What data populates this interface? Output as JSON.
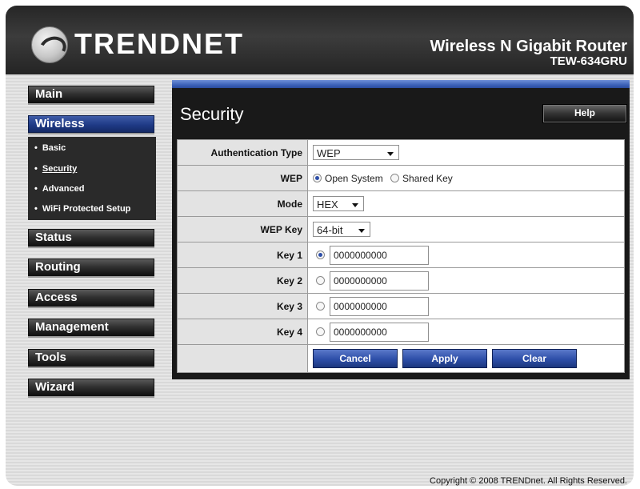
{
  "header": {
    "brand": "TRENDNET",
    "product_name": "Wireless N Gigabit Router",
    "model": "TEW-634GRU"
  },
  "sidebar": {
    "items": [
      {
        "label": "Main"
      },
      {
        "label": "Wireless",
        "active": true
      },
      {
        "label": "Status"
      },
      {
        "label": "Routing"
      },
      {
        "label": "Access"
      },
      {
        "label": "Management"
      },
      {
        "label": "Tools"
      },
      {
        "label": "Wizard"
      }
    ],
    "submenu": [
      {
        "label": "Basic"
      },
      {
        "label": "Security",
        "current": true
      },
      {
        "label": "Advanced"
      },
      {
        "label": "WiFi Protected Setup"
      }
    ]
  },
  "main": {
    "title": "Security",
    "help_label": "Help",
    "fields": {
      "auth_type": {
        "label": "Authentication Type",
        "value": "WEP"
      },
      "wep": {
        "label": "WEP",
        "options": [
          "Open System",
          "Shared Key"
        ],
        "selected": "Open System"
      },
      "mode": {
        "label": "Mode",
        "value": "HEX"
      },
      "wep_key": {
        "label": "WEP Key",
        "value": "64-bit"
      },
      "keys": [
        {
          "label": "Key 1",
          "value": "0000000000",
          "selected": true
        },
        {
          "label": "Key 2",
          "value": "0000000000",
          "selected": false
        },
        {
          "label": "Key 3",
          "value": "0000000000",
          "selected": false
        },
        {
          "label": "Key 4",
          "value": "0000000000",
          "selected": false
        }
      ]
    },
    "buttons": {
      "cancel": "Cancel",
      "apply": "Apply",
      "clear": "Clear"
    }
  },
  "footer": {
    "copyright": "Copyright © 2008 TRENDnet. All Rights Reserved."
  },
  "colors": {
    "accent_blue": "#2d4ea8",
    "header_dark": "#2f2f2f"
  }
}
